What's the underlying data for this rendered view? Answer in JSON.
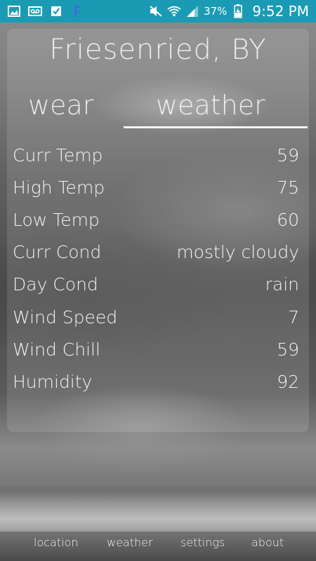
{
  "status_bar": {
    "battery_percent": "37%",
    "time": "9:52 PM",
    "notification_icons": [
      "image-icon",
      "voicemail-icon",
      "checkbox-icon",
      "f-app-icon"
    ],
    "system_icons": [
      "mute-icon",
      "wifi-icon",
      "signal-icon",
      "battery-charging-icon"
    ],
    "background_color": "#1b9bb3"
  },
  "header": {
    "location": "Friesenried, BY"
  },
  "tabs": [
    {
      "label": "wear"
    },
    {
      "label": "weather",
      "selected": true
    }
  ],
  "weather_rows": [
    {
      "label": "Curr Temp",
      "value": "59"
    },
    {
      "label": "High Temp",
      "value": "75"
    },
    {
      "label": "Low Temp",
      "value": "60"
    },
    {
      "label": "Curr Cond",
      "value": "mostly cloudy"
    },
    {
      "label": "Day Cond",
      "value": "rain"
    },
    {
      "label": "Wind Speed",
      "value": "7"
    },
    {
      "label": "Wind Chill",
      "value": "59"
    },
    {
      "label": "Humidity",
      "value": "92"
    }
  ],
  "bottom_nav": {
    "location": "location",
    "weather": "weather",
    "settings": "settings",
    "about": "about"
  }
}
